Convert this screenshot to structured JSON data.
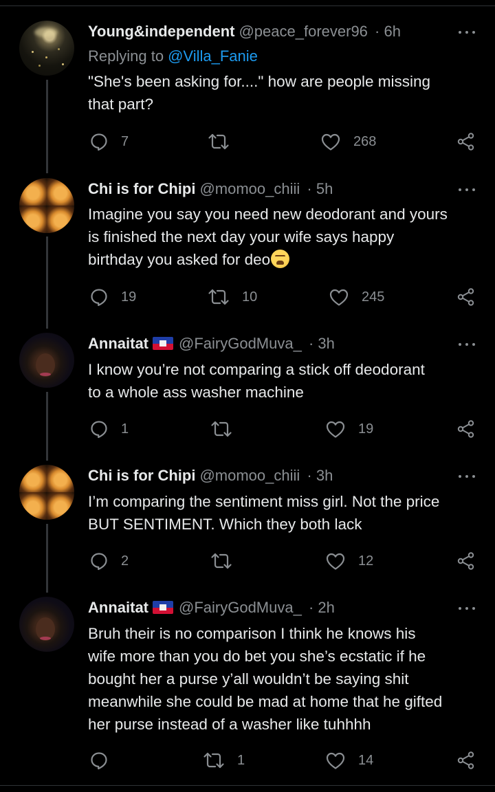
{
  "tweets": [
    {
      "name": "Young&independent",
      "handle": "@peace_forever96",
      "time": "· 6h",
      "replying_label": "Replying to",
      "replying_to": "@Villa_Fanie",
      "text": "\"She's been asking for....\" how are people missing\nthat part?",
      "replies": "7",
      "retweets": "",
      "likes": "268",
      "avatar": "moon-avatar"
    },
    {
      "name": "Chi is for Chipi",
      "handle": "@momoo_chiii",
      "time": "· 5h",
      "text": "Imagine you say you need new deodorant and yours\nis finished the next day your wife says happy\nbirthday you asked for deo",
      "emoji": "tired-face-emoji",
      "replies": "19",
      "retweets": "10",
      "likes": "245",
      "avatar": "collage-avatar"
    },
    {
      "name": "Annaitat",
      "flag": "haiti-flag-emoji",
      "handle": "@FairyGodMuva_",
      "time": "· 3h",
      "text": "I know you’re not comparing a stick off deodorant\nto a whole ass washer machine",
      "replies": "1",
      "retweets": "",
      "likes": "19",
      "avatar": "portrait-avatar"
    },
    {
      "name": "Chi is for Chipi",
      "handle": "@momoo_chiii",
      "time": "· 3h",
      "text": "I’m comparing the sentiment miss girl. Not the price\nBUT SENTIMENT. Which they both lack",
      "replies": "2",
      "retweets": "",
      "likes": "12",
      "avatar": "collage-avatar"
    },
    {
      "name": "Annaitat",
      "flag": "haiti-flag-emoji",
      "handle": "@FairyGodMuva_",
      "time": "· 2h",
      "text": "Bruh their is no comparison I think he knows his\nwife more than you do bet you she’s ecstatic if he\nbought her a purse y’all wouldn’t be saying shit\nmeanwhile she could be mad at home that he gifted\nher purse instead of a washer like tuhhhh",
      "replies": "",
      "retweets": "1",
      "likes": "14",
      "avatar": "portrait-avatar"
    }
  ],
  "icons": {
    "reply": "reply-icon",
    "retweet": "retweet-icon",
    "like": "heart-icon",
    "share": "share-icon",
    "more": "more-options-icon"
  },
  "colors": {
    "background": "#000000",
    "primary_text": "#e7e9ea",
    "secondary_text": "#8b8f93",
    "link": "#1d9bf0",
    "thread_line": "#333639"
  }
}
